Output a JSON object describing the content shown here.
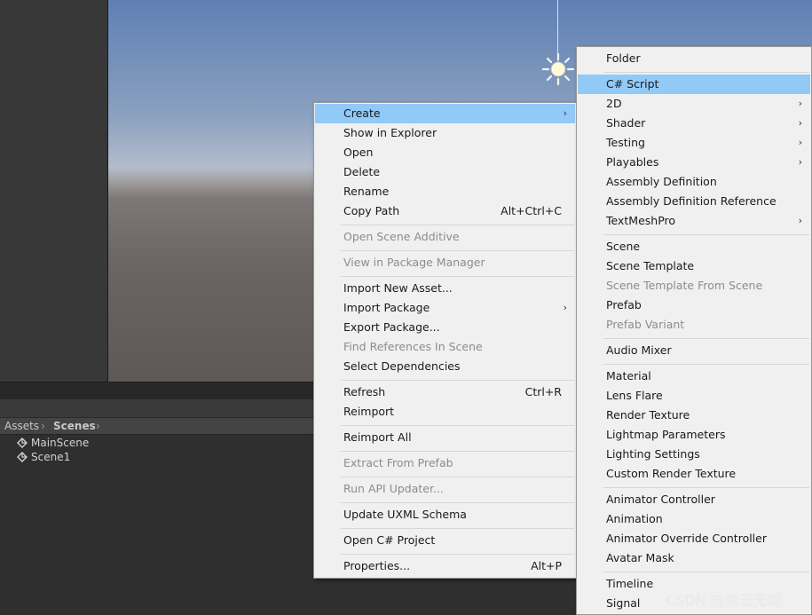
{
  "breadcrumb": {
    "root": "Assets",
    "current": "Scenes"
  },
  "scenes": [
    "MainScene",
    "Scene1"
  ],
  "menu1": {
    "items": [
      {
        "label": "Create",
        "arrow": true,
        "highlighted": true
      },
      {
        "label": "Show in Explorer"
      },
      {
        "label": "Open"
      },
      {
        "label": "Delete"
      },
      {
        "label": "Rename"
      },
      {
        "label": "Copy Path",
        "shortcut": "Alt+Ctrl+C"
      },
      {
        "label": "Open Scene Additive",
        "disabled": true
      },
      {
        "label": "View in Package Manager",
        "disabled": true
      },
      {
        "label": "Import New Asset..."
      },
      {
        "label": "Import Package",
        "arrow": true
      },
      {
        "label": "Export Package..."
      },
      {
        "label": "Find References In Scene",
        "disabled": true
      },
      {
        "label": "Select Dependencies"
      },
      {
        "label": "Refresh",
        "shortcut": "Ctrl+R"
      },
      {
        "label": "Reimport"
      },
      {
        "label": "Reimport All"
      },
      {
        "label": "Extract From Prefab",
        "disabled": true
      },
      {
        "label": "Run API Updater...",
        "disabled": true
      },
      {
        "label": "Update UXML Schema"
      },
      {
        "label": "Open C# Project"
      },
      {
        "label": "Properties...",
        "shortcut": "Alt+P"
      }
    ]
  },
  "menu2": {
    "items": [
      {
        "label": "Folder"
      },
      {
        "label": "C# Script",
        "highlighted": true
      },
      {
        "label": "2D",
        "arrow": true
      },
      {
        "label": "Shader",
        "arrow": true
      },
      {
        "label": "Testing",
        "arrow": true
      },
      {
        "label": "Playables",
        "arrow": true
      },
      {
        "label": "Assembly Definition"
      },
      {
        "label": "Assembly Definition Reference"
      },
      {
        "label": "TextMeshPro",
        "arrow": true
      },
      {
        "label": "Scene"
      },
      {
        "label": "Scene Template"
      },
      {
        "label": "Scene Template From Scene",
        "disabled": true
      },
      {
        "label": "Prefab"
      },
      {
        "label": "Prefab Variant",
        "disabled": true
      },
      {
        "label": "Audio Mixer"
      },
      {
        "label": "Material"
      },
      {
        "label": "Lens Flare"
      },
      {
        "label": "Render Texture"
      },
      {
        "label": "Lightmap Parameters"
      },
      {
        "label": "Lighting Settings"
      },
      {
        "label": "Custom Render Texture"
      },
      {
        "label": "Animator Controller"
      },
      {
        "label": "Animation"
      },
      {
        "label": "Animator Override Controller"
      },
      {
        "label": "Avatar Mask"
      },
      {
        "label": "Timeline"
      },
      {
        "label": "Signal"
      }
    ]
  },
  "arrow_glyph": "›",
  "watermark": "CSDN @紫云无堤",
  "colors": {
    "highlight": "#91c9f7",
    "menu_bg": "#f0f0f0",
    "disabled_text": "#8c8c8c"
  }
}
